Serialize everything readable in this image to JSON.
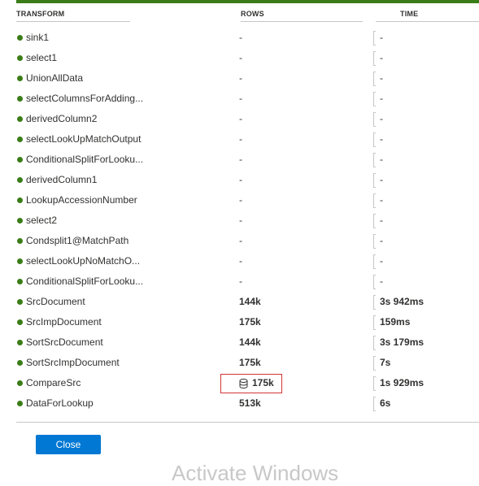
{
  "headers": {
    "transform": "TRANSFORM",
    "rows": "ROWS",
    "time": "TIME"
  },
  "rows": [
    {
      "name": "sink1",
      "rows": "-",
      "time": "-",
      "bold": false
    },
    {
      "name": "select1",
      "rows": "-",
      "time": "-",
      "bold": false
    },
    {
      "name": "UnionAllData",
      "rows": "-",
      "time": "-",
      "bold": false
    },
    {
      "name": "selectColumnsForAdding...",
      "rows": "-",
      "time": "-",
      "bold": false
    },
    {
      "name": "derivedColumn2",
      "rows": "-",
      "time": "-",
      "bold": false
    },
    {
      "name": "selectLookUpMatchOutput",
      "rows": "-",
      "time": "-",
      "bold": false
    },
    {
      "name": "ConditionalSplitForLooku...",
      "rows": "-",
      "time": "-",
      "bold": false
    },
    {
      "name": "derivedColumn1",
      "rows": "-",
      "time": "-",
      "bold": false
    },
    {
      "name": "LookupAccessionNumber",
      "rows": "-",
      "time": "-",
      "bold": false
    },
    {
      "name": "select2",
      "rows": "-",
      "time": "-",
      "bold": false
    },
    {
      "name": "Condsplit1@MatchPath",
      "rows": "-",
      "time": "-",
      "bold": false
    },
    {
      "name": "selectLookUpNoMatchO...",
      "rows": "-",
      "time": "-",
      "bold": false
    },
    {
      "name": "ConditionalSplitForLooku...",
      "rows": "-",
      "time": "-",
      "bold": false
    },
    {
      "name": "SrcDocument",
      "rows": "144k",
      "time": "3s 942ms",
      "bold": true
    },
    {
      "name": "SrcImpDocument",
      "rows": "175k",
      "time": "159ms",
      "bold": true
    },
    {
      "name": "SortSrcDocument",
      "rows": "144k",
      "time": "3s 179ms",
      "bold": true
    },
    {
      "name": "SortSrcImpDocument",
      "rows": "175k",
      "time": "7s",
      "bold": true
    },
    {
      "name": "CompareSrc",
      "rows": "175k",
      "time": "1s 929ms",
      "bold": true,
      "highlighted": true,
      "icon": "cache-icon"
    },
    {
      "name": "DataForLookup",
      "rows": "513k",
      "time": "6s",
      "bold": true
    }
  ],
  "close_label": "Close",
  "watermark": "Activate Windows",
  "colors": {
    "status_dot": "#3a7d18",
    "highlight_border": "#d13438",
    "button": "#0078d4"
  }
}
